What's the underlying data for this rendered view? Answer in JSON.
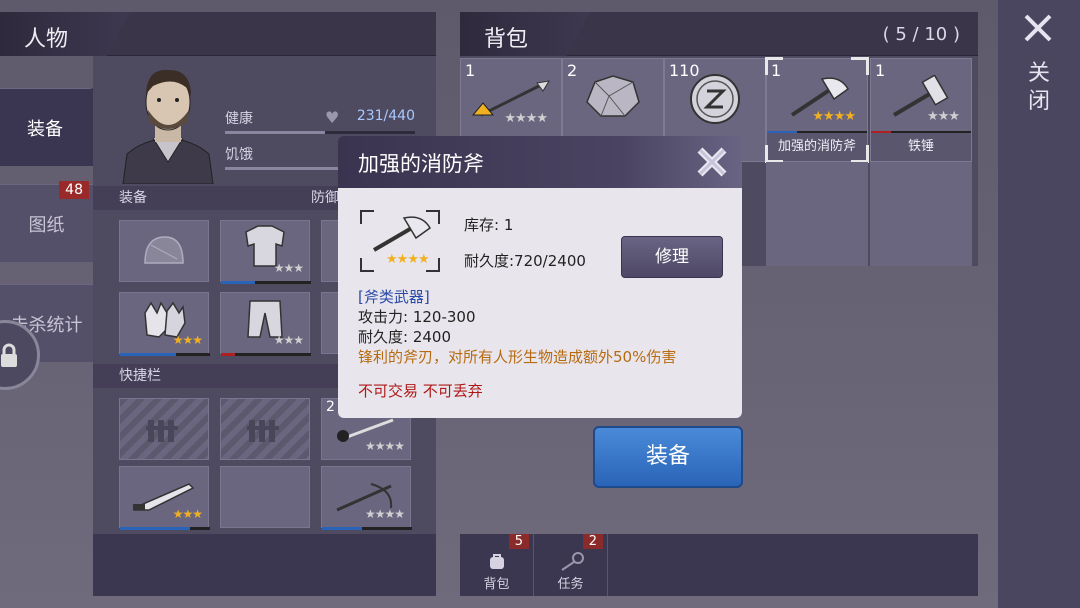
{
  "character": {
    "title": "人物",
    "tabs": [
      {
        "label": "装备"
      },
      {
        "label": "图纸",
        "badge": "48"
      },
      {
        "label": "击杀统计"
      }
    ],
    "stats": [
      {
        "label": "健康",
        "value": "231/440",
        "fraction": 0.525
      },
      {
        "label": "饥饿",
        "value": "",
        "fraction": 0.6
      }
    ],
    "equip_section": "装备",
    "defense_label": "防御",
    "quickbar_section": "快捷栏",
    "equip_slots": [
      {
        "item": "helmet-icon",
        "stars": 0
      },
      {
        "item": "jacket-icon",
        "stars": 3,
        "lit": 0
      },
      {
        "item": "gloves-icon",
        "stars": 3,
        "lit": 3
      },
      {
        "item": "pants-icon",
        "stars": 3,
        "lit": 0
      }
    ],
    "quick_slots": [
      {
        "item": "locked-slot",
        "count": ""
      },
      {
        "item": "locked-slot",
        "count": ""
      },
      {
        "item": "pickaxe-icon",
        "count": "2",
        "stars": 4,
        "lit": 0
      },
      {
        "item": "machete-icon",
        "count": "",
        "stars": 3,
        "lit": 3
      },
      {
        "item": "empty-slot",
        "count": ""
      },
      {
        "item": "crossbow-icon",
        "count": "",
        "stars": 4,
        "lit": 0
      }
    ]
  },
  "backpack": {
    "title": "背包",
    "capacity": "( 5 / 10 )",
    "items": [
      {
        "count": "1",
        "name": "",
        "icon": "spear-icon",
        "stars": 4,
        "lit": 0
      },
      {
        "count": "2",
        "name": "",
        "icon": "ore-icon",
        "stars": 0,
        "lit": 0
      },
      {
        "count": "110",
        "name": "",
        "icon": "coin-icon",
        "stars": 0,
        "lit": 0
      },
      {
        "count": "1",
        "name": "加强的消防斧",
        "icon": "axe-icon",
        "stars": 4,
        "lit": 4
      },
      {
        "count": "1",
        "name": "铁锤",
        "icon": "hammer-icon",
        "stars": 3,
        "lit": 0
      }
    ],
    "tabs": [
      {
        "label": "背包",
        "badge": "5",
        "icon": "backpack-icon"
      },
      {
        "label": "任务",
        "badge": "2",
        "icon": "key-icon"
      }
    ],
    "equip_button": "装备"
  },
  "close": {
    "label": "关闭"
  },
  "modal": {
    "title": "加强的消防斧",
    "stock": "库存: 1",
    "durability_top": "耐久度:720/2400",
    "repair_button": "修理",
    "item_stars": 4,
    "category": "[斧类武器]",
    "attack": "攻击力: 120-300",
    "durability": "耐久度: 2400",
    "effect": "锋利的斧刃，对所有人形生物造成额外50%伤害",
    "restriction": "不可交易 不可丢弃"
  },
  "colors": {
    "star_lit": "#f0b020",
    "category_text": "#2a4aa8",
    "effect_text": "#b86a10",
    "restriction_text": "#b01818",
    "equip_button": "#3a78c8"
  }
}
